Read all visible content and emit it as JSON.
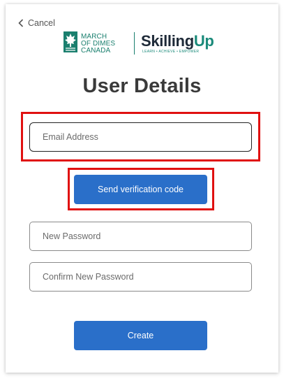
{
  "nav": {
    "cancel_label": "Cancel"
  },
  "logos": {
    "mod_line1": "MARCH",
    "mod_line2": "OF DIMES",
    "mod_line3": "CANADA",
    "skilling_word_a": "Skilling",
    "skilling_word_b": "Up",
    "skilling_tagline": "LEARN • ACHIEVE • EMPOWER"
  },
  "page": {
    "title": "User Details"
  },
  "form": {
    "email_placeholder": "Email Address",
    "send_code_label": "Send verification code",
    "new_password_placeholder": "New Password",
    "confirm_password_placeholder": "Confirm New Password",
    "create_label": "Create"
  },
  "colors": {
    "primary_button": "#2a6fc9",
    "highlight_box": "#e01010",
    "brand_teal": "#1a7f6e",
    "title_text": "#3a3a3a"
  },
  "icons": {
    "cancel": "chevron-left-icon",
    "mod_logo": "maple-leaf-icon"
  }
}
